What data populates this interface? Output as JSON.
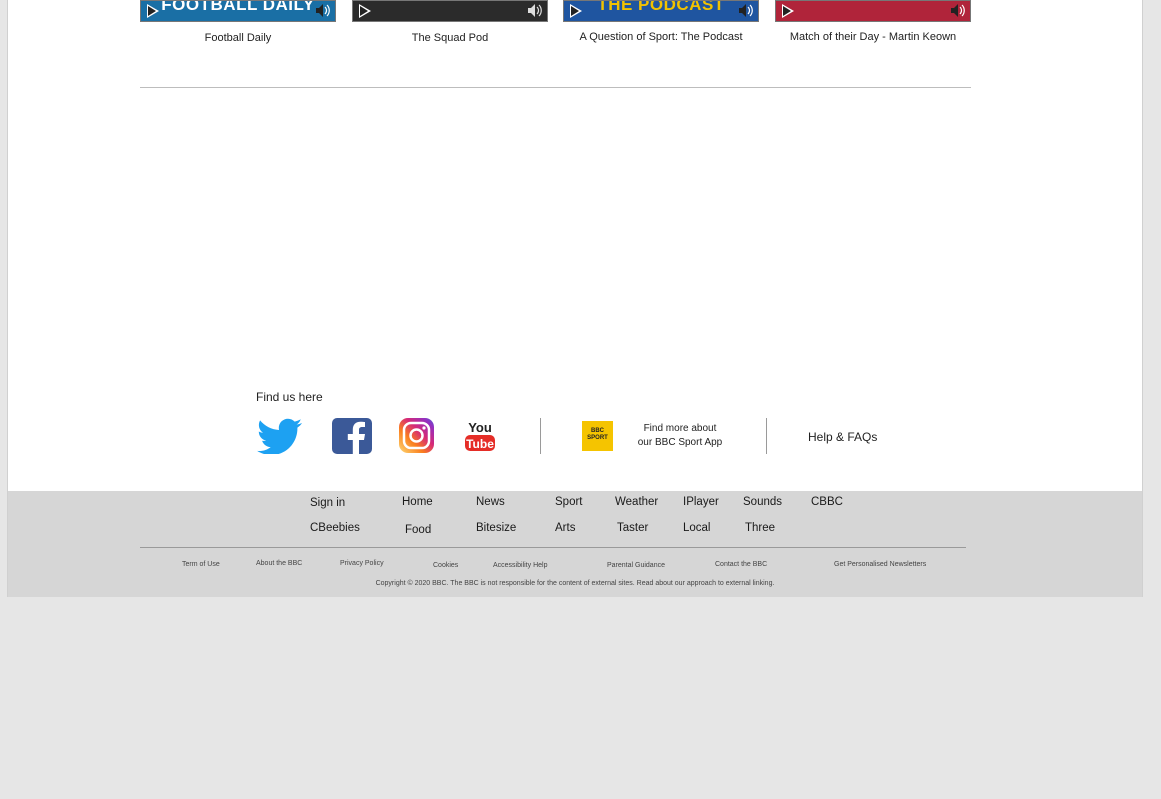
{
  "podcasts": [
    {
      "art": "FOOTBALL DAILY",
      "caption": "Football Daily"
    },
    {
      "art": "",
      "caption": "The Squad Pod"
    },
    {
      "art": "THE PODCAST",
      "caption": "A Question of Sport: The Podcast"
    },
    {
      "art": "",
      "caption": "Match of their Day - Martin Keown"
    }
  ],
  "find_us": {
    "title": "Find us here",
    "social": [
      "twitter-icon",
      "facebook-icon",
      "instagram-icon",
      "youtube-icon"
    ],
    "app_badge": "BBC SPORT",
    "app_text_line1": "Find more about",
    "app_text_line2": "our BBC Sport App",
    "help": "Help & FAQs"
  },
  "footer": {
    "nav_row1": [
      "Sign in",
      "Home",
      "News",
      "Sport",
      "Weather",
      "IPlayer",
      "Sounds",
      "CBBC"
    ],
    "nav_row2": [
      "CBeebies",
      "Food",
      "Bitesize",
      "Arts",
      "Taster",
      "Local",
      "Three"
    ],
    "links": [
      "Term of Use",
      "About the BBC",
      "Privacy Policy",
      "Cookies",
      "Accessibility Help",
      "Parental Guidance",
      "Contact the BBC",
      "Get Personalised Newsletters"
    ],
    "copyright": "Copyright © 2020 BBC. The BBC is not responsible for the content of external sites. Read about our approach to external linking."
  },
  "colors": {
    "page_bg": "#e6e6e6",
    "footer_bg": "#d6d6d6",
    "app_badge": "#f5c400",
    "twitter": "#1da1f2",
    "facebook": "#3b5998",
    "youtube": "#e52d27"
  }
}
